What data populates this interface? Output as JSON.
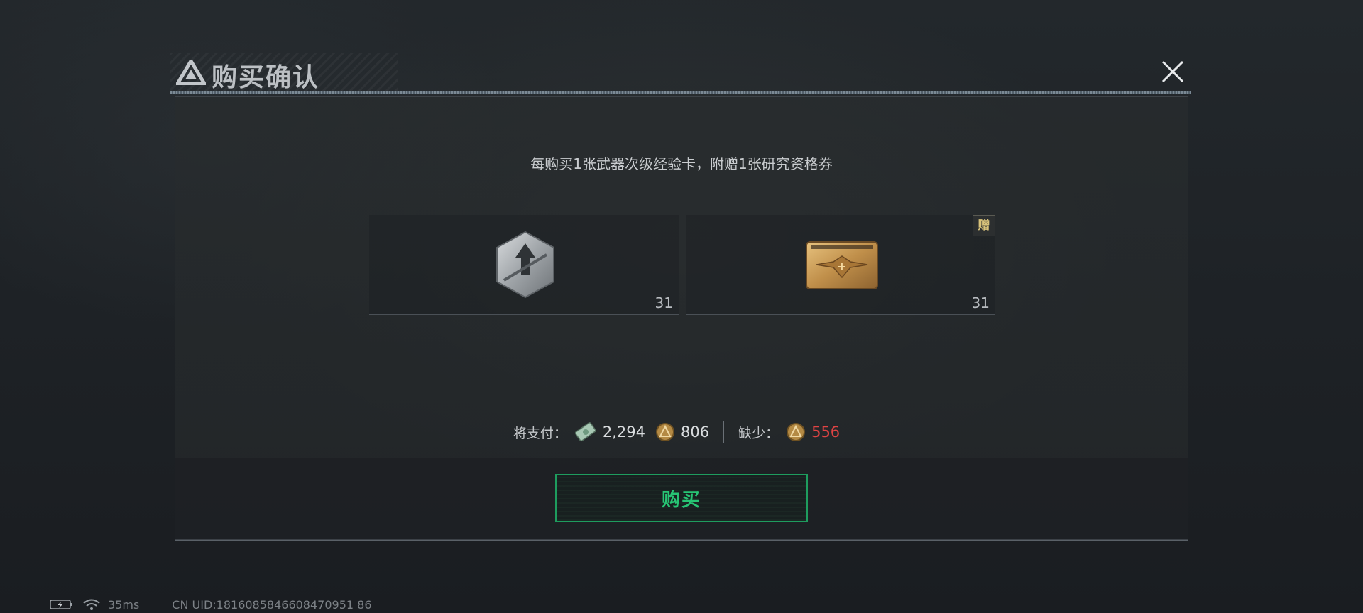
{
  "dialog": {
    "title": "购买确认",
    "promo_text": "每购买1张武器次级经验卡，附赠1张研究资格券",
    "items": [
      {
        "name": "武器次级经验卡",
        "icon": "weapon-xp-card-icon",
        "quantity": "31"
      },
      {
        "name": "研究资格券",
        "icon": "research-voucher-icon",
        "quantity": "31",
        "badge": "赠"
      }
    ],
    "cost": {
      "label": "将支付：",
      "currency_a_amount": "2,294",
      "currency_b_amount": "806",
      "shortage_label": "缺少：",
      "shortage_amount": "556"
    },
    "buy_label": "购买"
  },
  "status_bar": {
    "ping": "35ms",
    "uid": "CN UID:1816085846608470951 86"
  },
  "colors": {
    "accent_green": "#27c474",
    "shortage_red": "#e04444",
    "gift_gold": "#d8c27a"
  }
}
